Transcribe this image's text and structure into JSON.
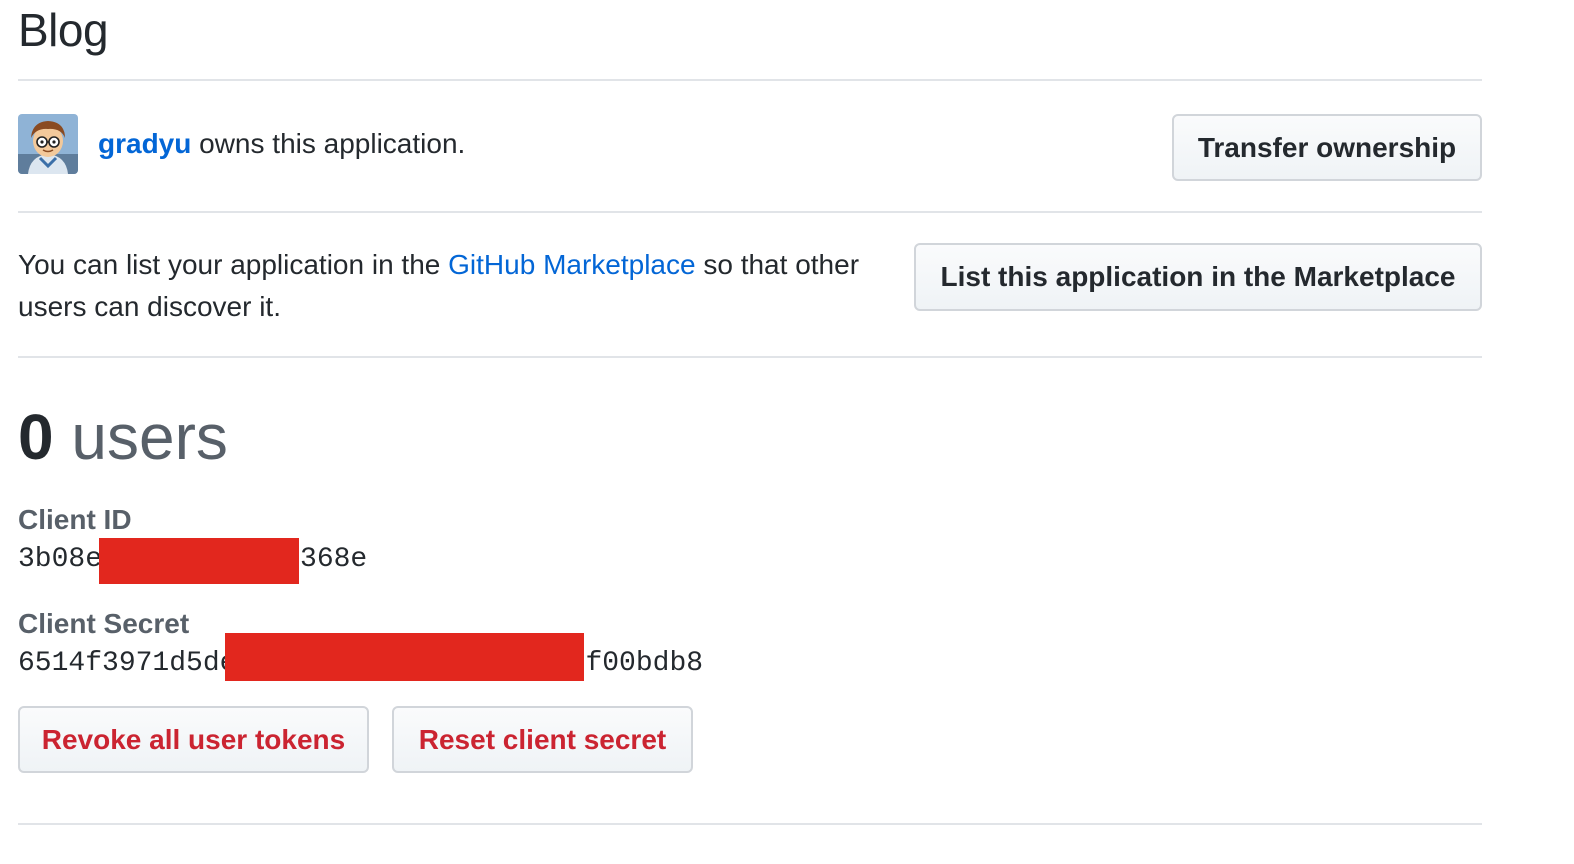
{
  "app": {
    "title": "Blog"
  },
  "owner": {
    "username": "gradyu",
    "owns_text": " owns this application.",
    "transfer_button": "Transfer ownership"
  },
  "marketplace": {
    "text_before": "You can list your application in the ",
    "link_text": "GitHub Marketplace",
    "text_after": " so that other users can discover it.",
    "list_button": "List this application in the Marketplace"
  },
  "users": {
    "count": "0",
    "label": " users"
  },
  "credentials": {
    "client_id_label": "Client ID",
    "client_id_prefix": "3b08e",
    "client_id_suffix": "368e",
    "client_secret_label": "Client Secret",
    "client_secret_prefix": "6514f3971d5de",
    "client_secret_suffix": "f00bdb8",
    "redaction_color": "#e2271e"
  },
  "actions": {
    "revoke_button": "Revoke all user tokens",
    "reset_button": "Reset client secret"
  }
}
